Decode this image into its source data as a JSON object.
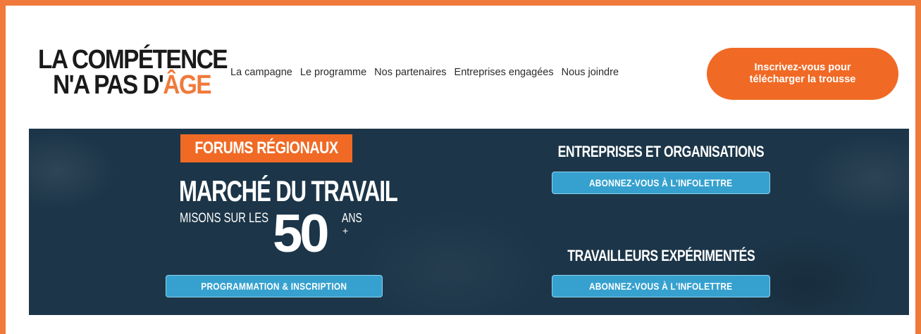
{
  "logo": {
    "line1": "LA COMPÉTENCE",
    "line2_prefix": "N'A PAS D'",
    "line2_accent": "ÂGE"
  },
  "nav": {
    "items": [
      {
        "label": "La campagne"
      },
      {
        "label": "Le programme"
      },
      {
        "label": "Nos partenaires"
      },
      {
        "label": "Entreprises engagées"
      },
      {
        "label": "Nous joindre"
      }
    ]
  },
  "cta": {
    "line1": "Inscrivez-vous pour",
    "line2": "télécharger la trousse"
  },
  "banner": {
    "forums_tag": "FORUMS RÉGIONAUX",
    "title": "MARCHÉ DU TRAVAIL",
    "misons": "MISONS SUR LES",
    "fifty": "50",
    "ans": "ANS",
    "plus": "+",
    "program_button": "PROGRAMMATION & INSCRIPTION",
    "entreprises_heading": "ENTREPRISES ET ORGANISATIONS",
    "entreprises_button": "ABONNEZ-VOUS À L'INFOLETTRE",
    "travailleurs_heading": "TRAVAILLEURS EXPÉRIMENTÉS",
    "travailleurs_button": "ABONNEZ-VOUS À L'INFOLETTRE"
  },
  "colors": {
    "accent_orange": "#f07a3b",
    "cta_orange": "#f06a25",
    "banner_navy": "#1c3548",
    "button_blue": "#36a1cf"
  }
}
